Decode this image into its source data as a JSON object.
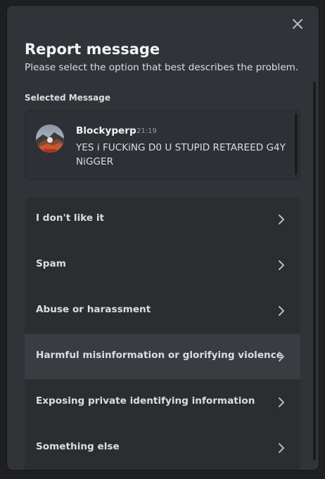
{
  "modal": {
    "title": "Report message",
    "subtitle": "Please select the option that best describes the problem.",
    "close_icon": "close-icon"
  },
  "selected_message": {
    "section_label": "Selected Message",
    "author": "Blockyperp",
    "timestamp": "21:19",
    "text": "YES i FUCKiNG D0 U STUPID RETAREED G4Y NiGGER",
    "avatar_icon": "user-avatar"
  },
  "options": [
    {
      "label": "I don't like it",
      "icon": "chevron-right-icon"
    },
    {
      "label": "Spam",
      "icon": "chevron-right-icon"
    },
    {
      "label": "Abuse or harassment",
      "icon": "chevron-right-icon"
    },
    {
      "label": "Harmful misinformation or glorifying violence",
      "icon": "chevron-right-icon"
    },
    {
      "label": "Exposing private identifying information",
      "icon": "chevron-right-icon"
    },
    {
      "label": "Something else",
      "icon": "chevron-right-icon"
    }
  ],
  "colors": {
    "modal_bg": "#313338",
    "option_bg": "#2b2d31",
    "option_hover_bg": "#393c41",
    "text_primary": "#f2f3f5",
    "text_secondary": "#dbdee1",
    "text_muted": "#949ba4"
  }
}
